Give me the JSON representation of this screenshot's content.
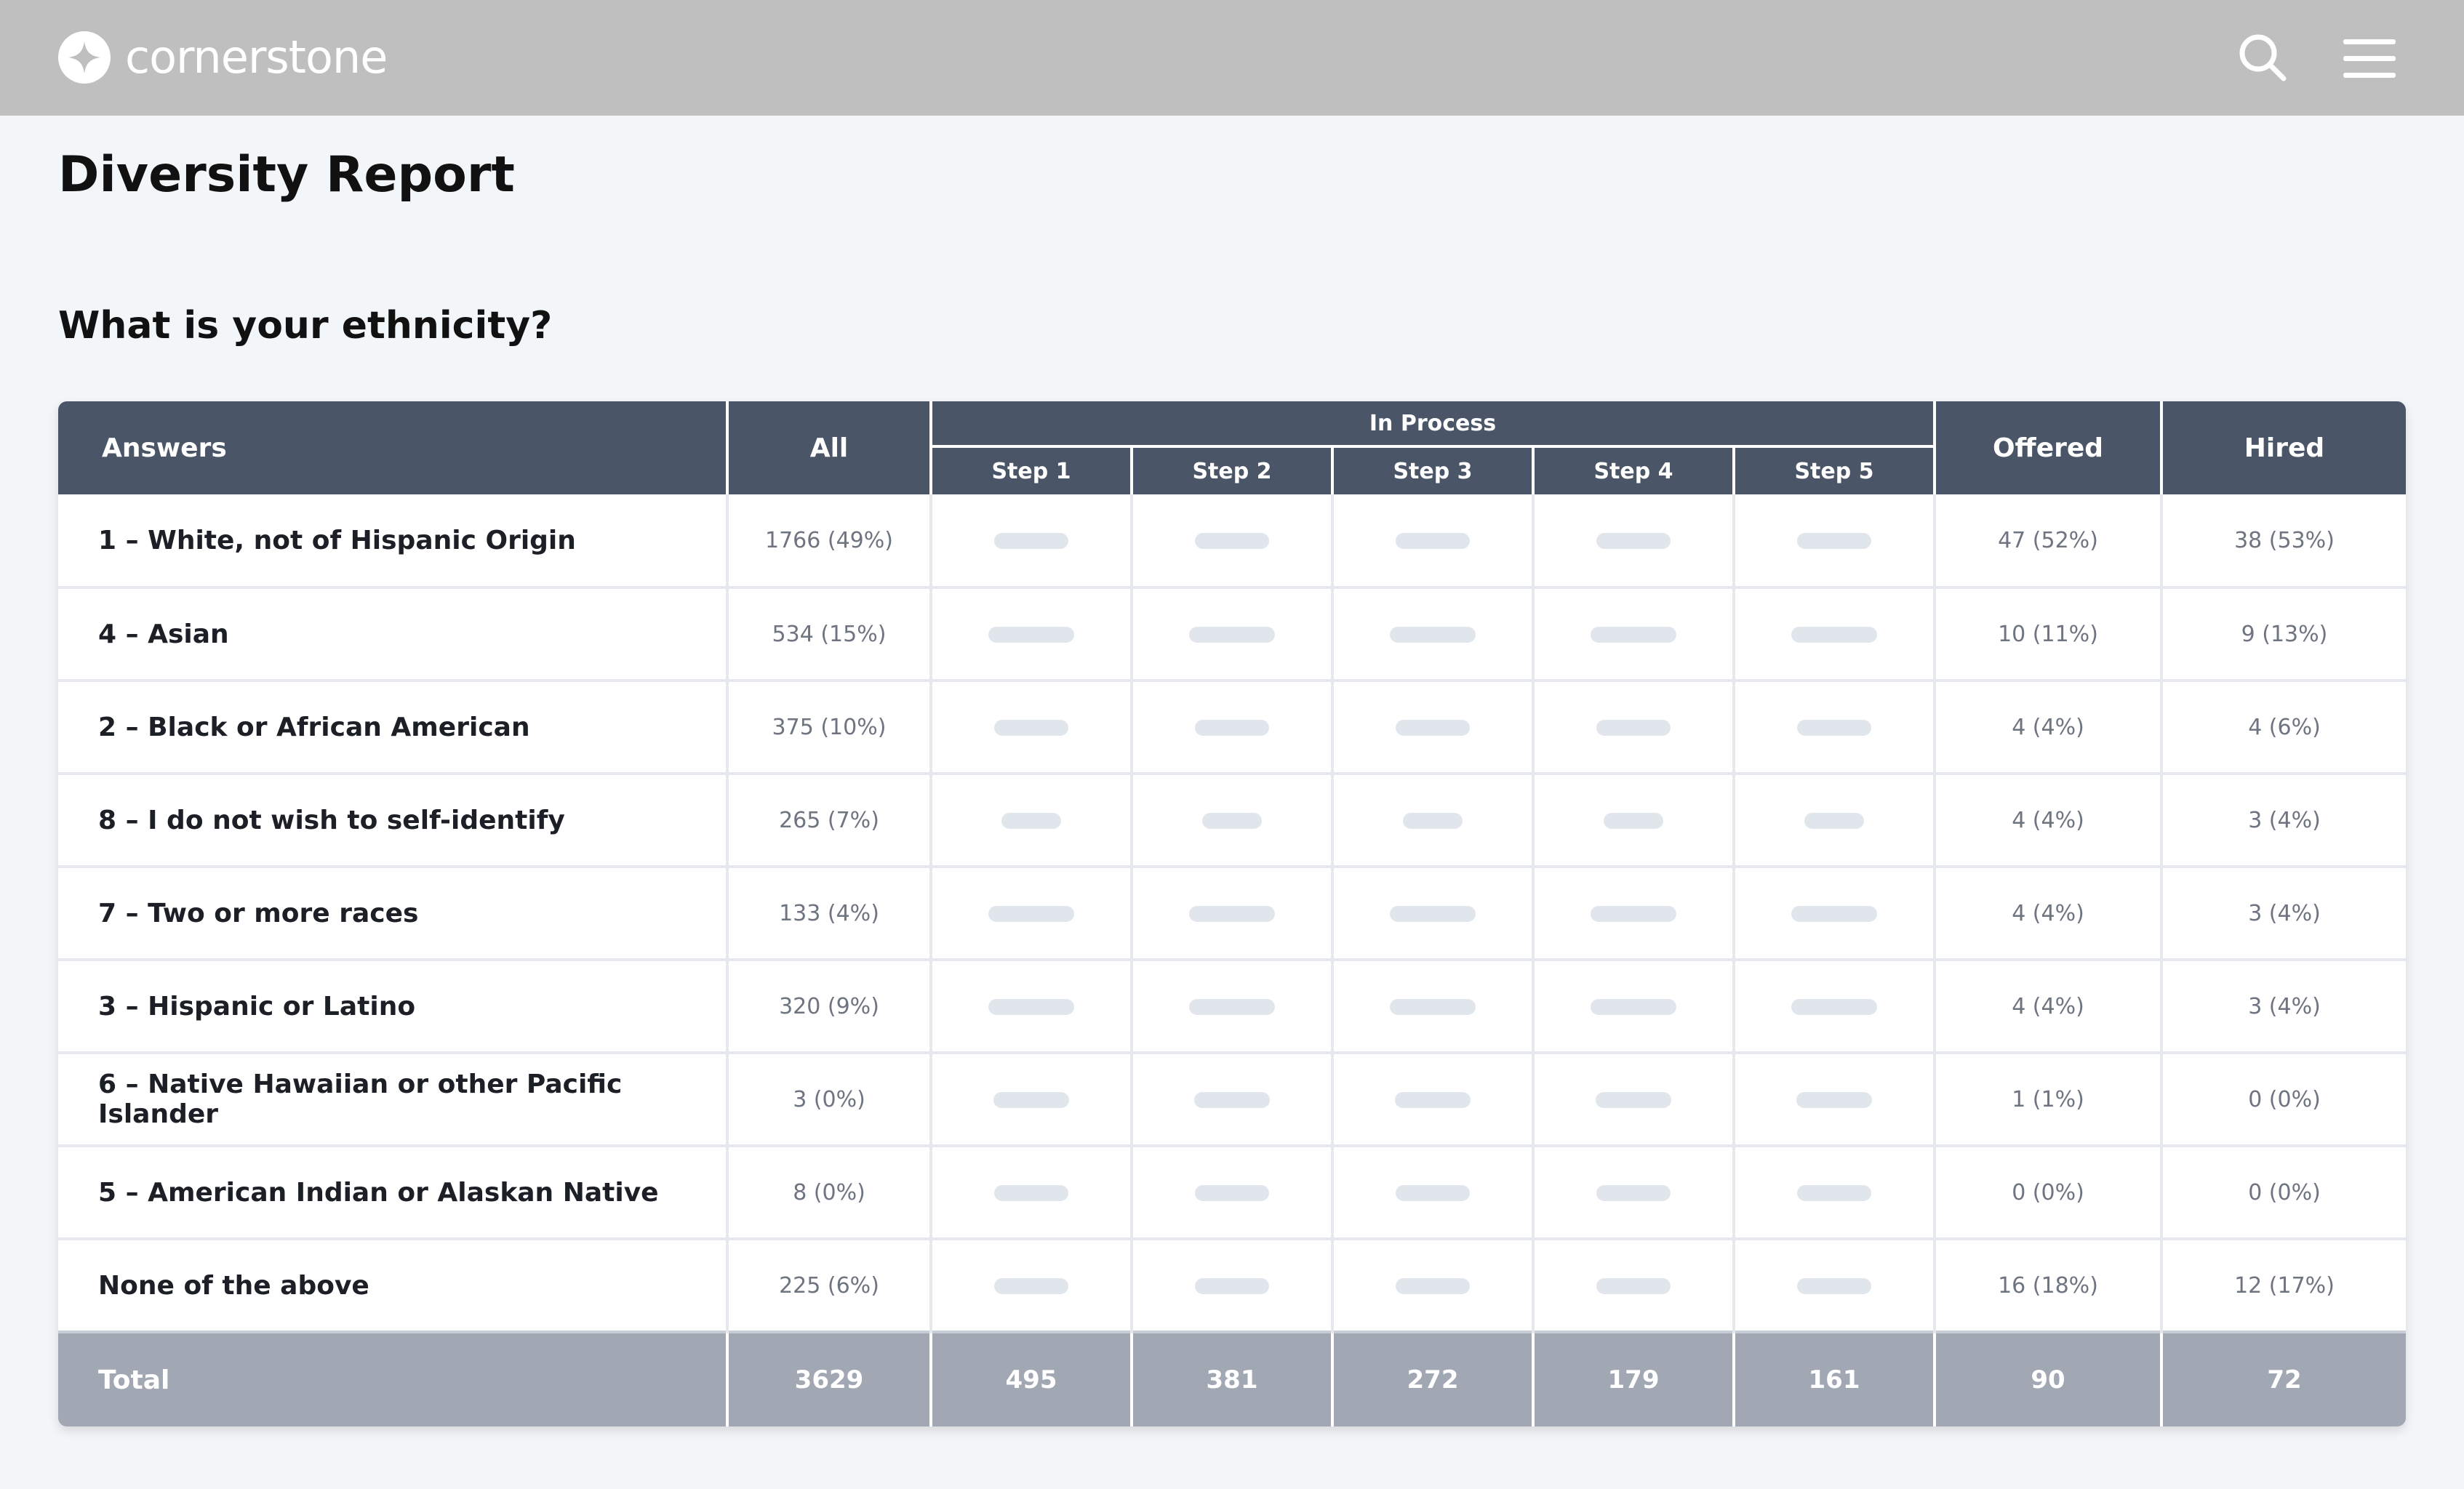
{
  "header": {
    "brand_name": "cornerstone",
    "icons": {
      "logo": "cornerstone-star-logo",
      "search": "search-icon",
      "menu": "hamburger-menu-icon"
    },
    "colors": {
      "bar_bg": "#bfbfbf",
      "table_header": "#4a5567",
      "total_row": "#a2a8b3",
      "placeholder_bar": "#e1e6ed"
    }
  },
  "page": {
    "title": "Diversity Report",
    "question": "What is your ethnicity?"
  },
  "table": {
    "headers": {
      "answers": "Answers",
      "all": "All",
      "in_process": "In Process",
      "steps": [
        "Step 1",
        "Step 2",
        "Step 3",
        "Step 4",
        "Step 5"
      ],
      "offered": "Offered",
      "hired": "Hired"
    },
    "rows": [
      {
        "answer": "1 – White, not of Hispanic Origin",
        "all": "1766 (49%)",
        "offered": "47 (52%)",
        "hired": "38 (53%)"
      },
      {
        "answer": "4 – Asian",
        "all": "534 (15%)",
        "offered": "10 (11%)",
        "hired": "9 (13%)"
      },
      {
        "answer": "2 – Black or African American",
        "all": "375 (10%)",
        "offered": "4 (4%)",
        "hired": "4 (6%)"
      },
      {
        "answer": "8 – I do not wish to self-identify",
        "all": "265 (7%)",
        "offered": "4 (4%)",
        "hired": "3 (4%)"
      },
      {
        "answer": "7 – Two or more races",
        "all": "133 (4%)",
        "offered": "4 (4%)",
        "hired": "3 (4%)"
      },
      {
        "answer": "3 – Hispanic or Latino",
        "all": "320 (9%)",
        "offered": "4 (4%)",
        "hired": "3 (4%)"
      },
      {
        "answer": "6 – Native Hawaiian or other Pacific Islander",
        "all": "3 (0%)",
        "offered": "1 (1%)",
        "hired": "0 (0%)"
      },
      {
        "answer": "5 – American Indian or Alaskan Native",
        "all": "8 (0%)",
        "offered": "0 (0%)",
        "hired": "0 (0%)"
      },
      {
        "answer": "None of the above",
        "all": "225 (6%)",
        "offered": "16 (18%)",
        "hired": "12 (17%)"
      }
    ],
    "total": {
      "label": "Total",
      "all": "3629",
      "steps": [
        "495",
        "381",
        "272",
        "179",
        "161"
      ],
      "offered": "90",
      "hired": "72"
    }
  }
}
